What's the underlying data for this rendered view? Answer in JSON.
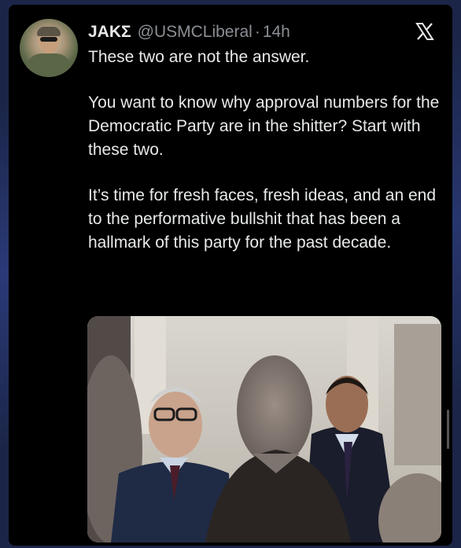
{
  "tweet": {
    "display_name": "JAKΣ",
    "handle": "@USMCLiberal",
    "separator": "·",
    "time": "14h",
    "paragraphs": [
      "These two are not the answer.",
      "You want to know why approval numbers for the Democratic Party are in the shitter? Start with these two.",
      "It’s time for fresh faces, fresh ideas, and an end to the performative bullshit that has been a hallmark of this party for the past decade."
    ]
  },
  "icons": {
    "platform": "x-logo-icon",
    "avatar": "profile-avatar"
  },
  "colors": {
    "background": "#1b2547",
    "card": "#000000",
    "text_primary": "#e7e9ea",
    "text_secondary": "#8b8f94"
  }
}
